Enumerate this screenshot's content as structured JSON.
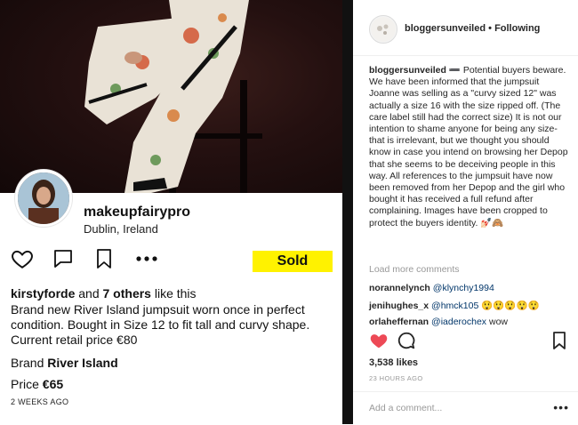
{
  "depop": {
    "seller_username": "makeupfairypro",
    "seller_location": "Dublin, Ireland",
    "sold_label": "Sold",
    "likes": {
      "first_user": "kirstyforde",
      "connector": "and",
      "others": "7 others",
      "suffix": "like this"
    },
    "description": "Brand new River Island jumpsuit worn once in perfect condition. Bought in Size 12 to fit tall and curvy shape. Current retail price €80",
    "brand_label": "Brand",
    "brand_value": "River Island",
    "price_label": "Price",
    "price_value": "€65",
    "posted": "2 WEEKS AGO",
    "icons": [
      "heart-icon",
      "comment-icon",
      "bookmark-icon",
      "more-icon"
    ]
  },
  "instagram": {
    "header": {
      "username": "bloggersunveiled",
      "separator": "•",
      "follow_state": "Following"
    },
    "caption": {
      "username": "bloggersunveiled",
      "text": "➖ Potential buyers beware. We have been informed that the jumpsuit Joanne was selling as a \"curvy sized 12\" was actually a size 16 with the size ripped off. (The care label still had the correct size) It is not our intention to shame anyone for being any size- that is irrelevant, but we thought you should know in case you intend on browsing her Depop that she seems to be deceiving people in this way. All references to the jumpsuit have now been removed from her Depop and the girl who bought it has received a full refund after complaining. Images have been cropped to protect the buyers identity. 💅🏻🙈"
    },
    "load_more": "Load more comments",
    "comments": [
      {
        "user": "norannelynch",
        "mention": "@klynchy1994",
        "text": ""
      },
      {
        "user": "jenihughes_x",
        "mention": "@hmck105",
        "text": "😲😲😲😲😲"
      },
      {
        "user": "orlaheffernan",
        "mention": "@iaderochex",
        "text": "wow"
      }
    ],
    "like_count": "3,538 likes",
    "time": "23 HOURS AGO",
    "add_comment_placeholder": "Add a comment...",
    "more_label": "•••",
    "colors": {
      "liked_heart": "#ed4956",
      "mention": "#003569",
      "muted": "#999999"
    }
  }
}
